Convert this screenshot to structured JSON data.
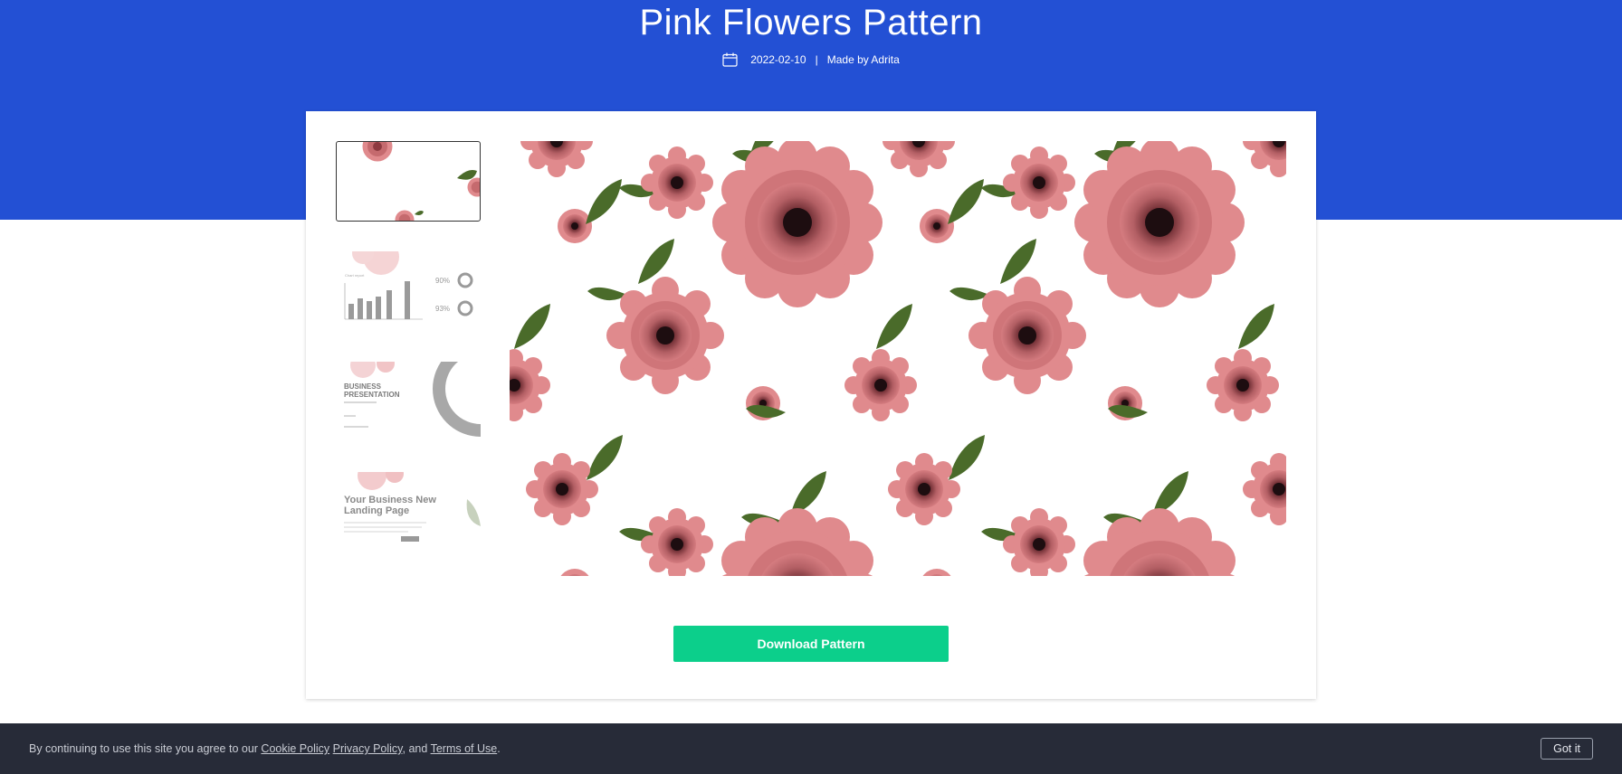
{
  "page": {
    "title": "Pink Flowers Pattern",
    "date": "2022-02-10",
    "separator": "|",
    "author": "Made by Adrita"
  },
  "thumbnails": [
    {
      "name": "pattern-preview",
      "active": true
    },
    {
      "name": "chart-slide",
      "stat1": "90%",
      "stat2": "93%"
    },
    {
      "name": "business-presentation-slide",
      "line1": "BUSINESS",
      "line2": "PRESENTATION"
    },
    {
      "name": "landing-page-slide",
      "line1": "Your Business New",
      "line2": "Landing Page"
    }
  ],
  "actions": {
    "download_label": "Download Pattern"
  },
  "cookie": {
    "prefix": "By continuing to use this site you agree to our",
    "cookie_policy": "Cookie Policy",
    "privacy_policy": "Privacy Policy",
    "and": ", and",
    "terms": "Terms of Use",
    "suffix": ".",
    "button": "Got it"
  },
  "colors": {
    "hero": "#2350d4",
    "button": "#0ccf8b",
    "petal_outer": "#e08a8d",
    "petal_mid": "#c56a6e",
    "petal_inner": "#8e3a40",
    "flower_core": "#1d0d10",
    "leaf": "#4a6b2a",
    "cookie_bg": "#272b38"
  },
  "icons": {
    "date": "calendar-icon"
  }
}
